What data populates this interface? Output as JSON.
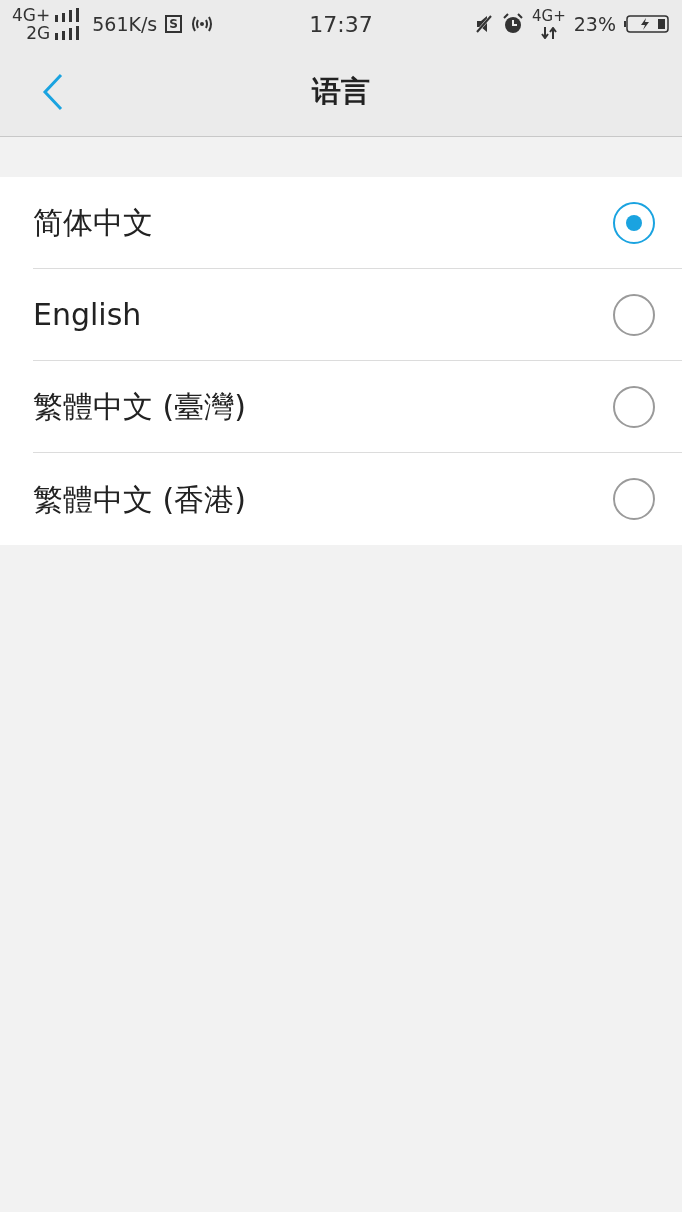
{
  "status_bar": {
    "network_top": "4G+",
    "network_bottom": "2G",
    "speed": "561K/s",
    "app_badge": "S",
    "time": "17:37",
    "data_network": "4G+",
    "battery": "23%"
  },
  "header": {
    "title": "语言"
  },
  "languages": [
    {
      "label": "简体中文",
      "selected": true
    },
    {
      "label": "English",
      "selected": false
    },
    {
      "label": "繁體中文 (臺灣)",
      "selected": false
    },
    {
      "label": "繁體中文 (香港)",
      "selected": false
    }
  ]
}
